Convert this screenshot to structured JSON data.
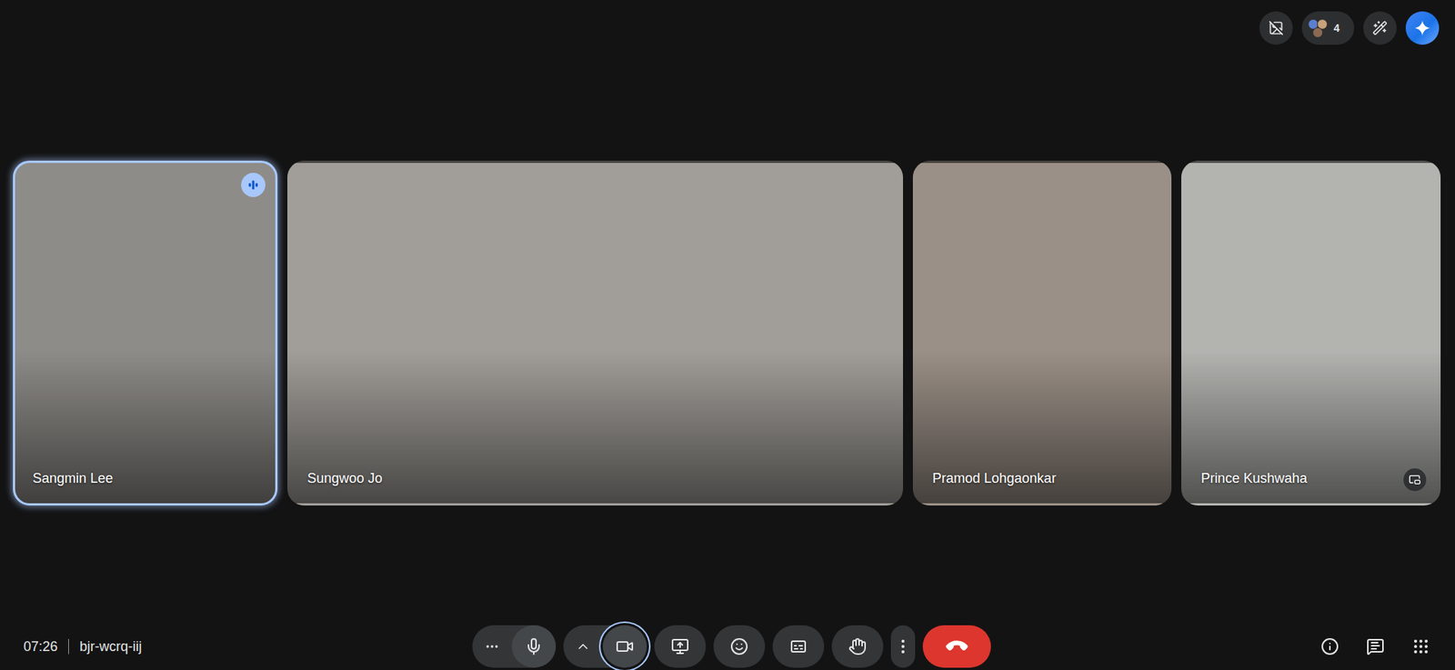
{
  "meeting": {
    "time": "07:26",
    "code": "bjr-wcrq-iij"
  },
  "top_bar": {
    "participant_count": "4"
  },
  "participants": [
    {
      "name": "Sangmin Lee",
      "speaking": true,
      "self": false
    },
    {
      "name": "Sungwoo Jo",
      "speaking": false,
      "self": false
    },
    {
      "name": "Pramod Lohgaonkar",
      "speaking": false,
      "self": false
    },
    {
      "name": "Prince Kushwaha",
      "speaking": false,
      "self": true
    }
  ],
  "controls": [
    {
      "kind": "audio",
      "focused": false
    },
    {
      "kind": "video",
      "focused": true
    },
    {
      "kind": "present",
      "focused": false
    },
    {
      "kind": "reactions",
      "focused": false
    },
    {
      "kind": "captions",
      "focused": false
    },
    {
      "kind": "hand",
      "focused": false
    },
    {
      "kind": "more",
      "focused": false
    },
    {
      "kind": "leave",
      "focused": false
    }
  ]
}
